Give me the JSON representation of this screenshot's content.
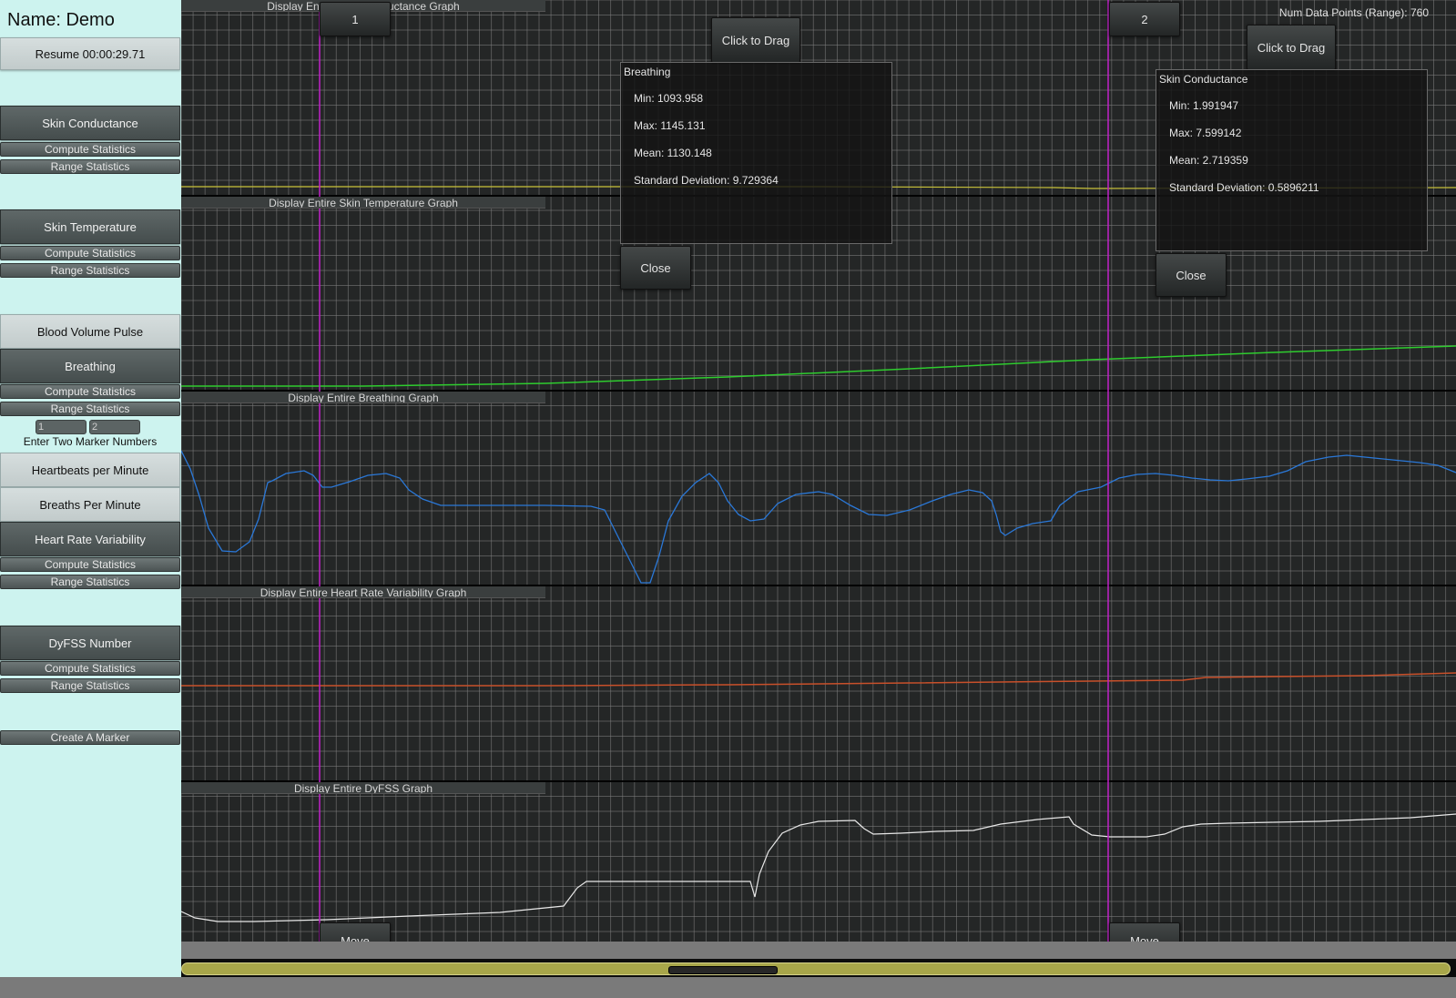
{
  "sidebar": {
    "name_label": "Name: Demo",
    "resume_button": "Resume 00:00:29.71",
    "skin_conductance": {
      "label": "Skin Conductance",
      "compute": "Compute Statistics",
      "range": "Range Statistics"
    },
    "skin_temperature": {
      "label": "Skin Temperature",
      "compute": "Compute Statistics",
      "range": "Range Statistics"
    },
    "blood_volume_pulse": "Blood Volume Pulse",
    "breathing": {
      "label": "Breathing",
      "compute": "Compute Statistics",
      "range": "Range Statistics"
    },
    "marker_inputs": [
      "1",
      "2"
    ],
    "marker_hint": "Enter Two Marker Numbers",
    "heartbeats_per_minute": "Heartbeats per Minute",
    "breaths_per_minute": "Breaths Per Minute",
    "heart_rate_variability": {
      "label": "Heart Rate Variability",
      "compute": "Compute Statistics",
      "range": "Range Statistics"
    },
    "dyfss": {
      "label": "DyFSS Number",
      "compute": "Compute Statistics",
      "range": "Range Statistics"
    },
    "create_marker": "Create A Marker"
  },
  "graphs": {
    "skin_conductance_title": "Display Entire Skin Conductance Graph",
    "skin_temperature_title": "Display Entire Skin Temperature Graph",
    "breathing_title": "Display Entire Breathing Graph",
    "hrv_title": "Display Entire Heart Rate Variability Graph",
    "dyfss_title": "Display Entire DyFSS Graph",
    "num_points": "Num Data Points (Range): 760",
    "markers": [
      {
        "number": "1",
        "move_label": "Move"
      },
      {
        "number": "2",
        "move_label": "Move"
      }
    ],
    "colors": {
      "skin_conductance_line": "#c9c23a",
      "skin_temperature_line": "#2ecc2e",
      "breathing_line": "#2a78d8",
      "hrv_line": "#c8502a",
      "dyfss_line": "#e8e8e8",
      "marker_line": "#c020c8",
      "grid": "#808080"
    }
  },
  "stat_windows": {
    "breathing": {
      "drag_label": "Click to Drag",
      "title": "Breathing",
      "min": "Min: 1093.958",
      "max": "Max: 1145.131",
      "mean": "Mean: 1130.148",
      "std": "Standard Deviation: 9.729364",
      "close": "Close"
    },
    "skin_conductance": {
      "drag_label": "Click to Drag",
      "title": "Skin Conductance",
      "min": "Min: 1.991947",
      "max": "Max: 7.599142",
      "mean": "Mean: 2.719359",
      "std": "Standard Deviation: 0.5896211",
      "close": "Close"
    }
  }
}
